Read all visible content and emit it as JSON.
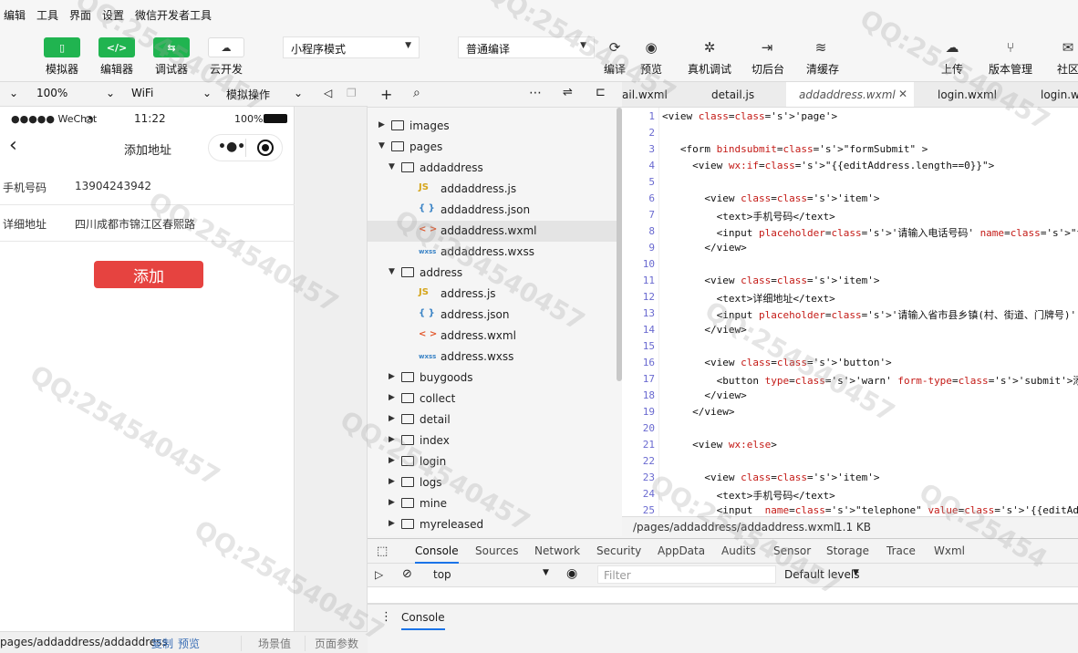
{
  "menu": [
    "编辑",
    "工具",
    "界面",
    "设置",
    "微信开发者工具"
  ],
  "toolbar": {
    "simulator": "模拟器",
    "editor": "编辑器",
    "debugger": "调试器",
    "cloud": "云开发",
    "mode_select": "小程序模式",
    "compile_select": "普通编译",
    "compile": "编译",
    "preview": "预览",
    "remote_debug": "真机调试",
    "background": "切后台",
    "clear_cache": "清缓存",
    "upload": "上传",
    "version": "版本管理",
    "community": "社区"
  },
  "subbar": {
    "zoom": "100%",
    "network": "WiFi",
    "operation": "模拟操作"
  },
  "phone": {
    "carrier": "●●●●● WeChat",
    "time": "11:22",
    "battery": "100%",
    "nav_title": "添加地址",
    "phone_label": "手机号码",
    "phone_value": "13904243942",
    "addr_label": "详细地址",
    "addr_value": "四川成都市锦江区春熙路",
    "add_button": "添加"
  },
  "tree": [
    {
      "name": "images",
      "type": "folder",
      "depth": 0,
      "open": false
    },
    {
      "name": "pages",
      "type": "folder",
      "depth": 0,
      "open": true
    },
    {
      "name": "addaddress",
      "type": "folder",
      "depth": 1,
      "open": true
    },
    {
      "name": "addaddress.js",
      "type": "js",
      "depth": 2
    },
    {
      "name": "addaddress.json",
      "type": "json",
      "depth": 2
    },
    {
      "name": "addaddress.wxml",
      "type": "wxml",
      "depth": 2,
      "selected": true
    },
    {
      "name": "addaddress.wxss",
      "type": "wxss",
      "depth": 2
    },
    {
      "name": "address",
      "type": "folder",
      "depth": 1,
      "open": true
    },
    {
      "name": "address.js",
      "type": "js",
      "depth": 2
    },
    {
      "name": "address.json",
      "type": "json",
      "depth": 2
    },
    {
      "name": "address.wxml",
      "type": "wxml",
      "depth": 2
    },
    {
      "name": "address.wxss",
      "type": "wxss",
      "depth": 2
    },
    {
      "name": "buygoods",
      "type": "folder",
      "depth": 1,
      "open": false
    },
    {
      "name": "collect",
      "type": "folder",
      "depth": 1,
      "open": false
    },
    {
      "name": "detail",
      "type": "folder",
      "depth": 1,
      "open": false
    },
    {
      "name": "index",
      "type": "folder",
      "depth": 1,
      "open": false
    },
    {
      "name": "login",
      "type": "folder",
      "depth": 1,
      "open": false
    },
    {
      "name": "logs",
      "type": "folder",
      "depth": 1,
      "open": false
    },
    {
      "name": "mine",
      "type": "folder",
      "depth": 1,
      "open": false
    },
    {
      "name": "myreleased",
      "type": "folder",
      "depth": 1,
      "open": false
    }
  ],
  "tabs": [
    "ail.wxml",
    "detail.js",
    "addaddress.wxml",
    "login.wxml",
    "login.w"
  ],
  "code": [
    "<view class='page'>",
    "",
    "   <form bindsubmit=\"formSubmit\" >",
    "     <view wx:if=\"{{editAddress.length==0}}\">",
    "",
    "       <view class='item'>",
    "         <text>手机号码</text>",
    "         <input placeholder='请输入电话号码' name=\"tel\"/>",
    "       </view>",
    "",
    "       <view class='item'>",
    "         <text>详细地址</text>",
    "         <input placeholder='请输入省市县乡镇(村、街道、门牌号)' name",
    "       </view>",
    "",
    "       <view class='button'>",
    "         <button type='warn' form-type='submit'>添加</button>",
    "       </view>",
    "     </view>",
    "",
    "     <view wx:else>",
    "",
    "       <view class='item'>",
    "         <text>手机号码</text>",
    "         <input  name=\"telephone\" value='{{editAddress.tel}}'/>"
  ],
  "filebar": {
    "path": "/pages/addaddress/addaddress.wxml",
    "size": "1.1 KB"
  },
  "devtools": {
    "tabs": [
      "Console",
      "Sources",
      "Network",
      "Security",
      "AppData",
      "Audits",
      "Sensor",
      "Storage",
      "Trace",
      "Wxml"
    ],
    "context": "top",
    "filter_placeholder": "Filter",
    "levels": "Default levels",
    "drawer_tab": "Console"
  },
  "bottom": {
    "path": "pages/addaddress/addaddress",
    "copy": "复制",
    "preview": "预览",
    "scene": "场景值",
    "params": "页面参数"
  }
}
